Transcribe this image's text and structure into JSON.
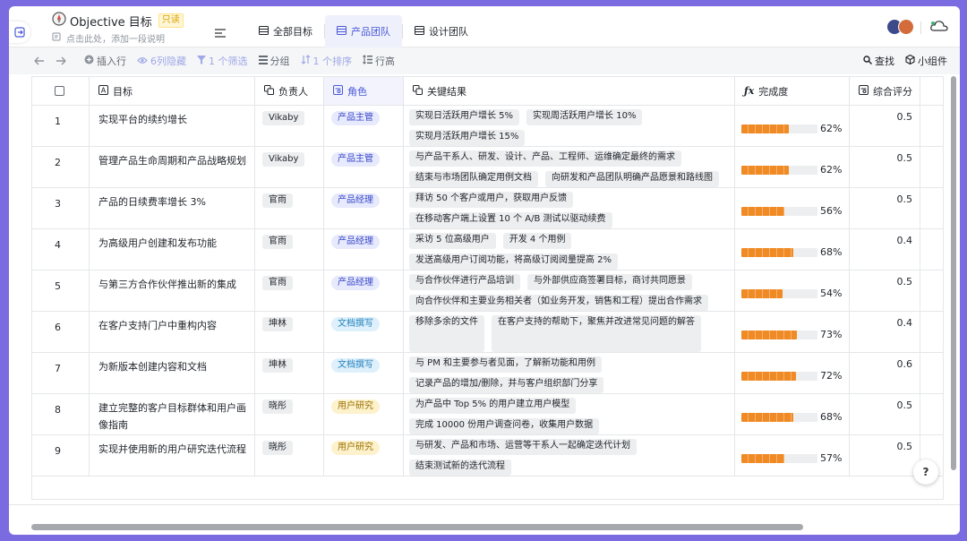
{
  "app": {
    "title": "Objective 目标",
    "readonly_badge": "只读",
    "description": "点击此处，添加一段说明"
  },
  "tabs": [
    {
      "label": "全部目标",
      "active": false
    },
    {
      "label": "产品团队",
      "active": true
    },
    {
      "label": "设计团队",
      "active": false
    }
  ],
  "toolbar": {
    "insert_row": "插入行",
    "hidden_cols": "6列隐藏",
    "filter": "1 个筛选",
    "group": "分组",
    "sort": "1 个排序",
    "row_height": "行高",
    "find": "查找",
    "widgets": "小组件"
  },
  "columns": [
    "目标",
    "负责人",
    "角色",
    "关键结果",
    "完成度",
    "综合评分"
  ],
  "role_colors": {
    "产品主管": {
      "bg": "#e7e9fc",
      "fg": "#3a49c9"
    },
    "产品经理": {
      "bg": "#e7e9fc",
      "fg": "#3a49c9"
    },
    "文档撰写": {
      "bg": "#ddf0fb",
      "fg": "#2581bd"
    },
    "用户研究": {
      "bg": "#fdf2cc",
      "fg": "#9a6f00"
    }
  },
  "accent_color": "#f08a24",
  "rows": [
    {
      "num": "1",
      "objective": "实现平台的续约增长",
      "owner": "Vikaby",
      "role": "产品主管",
      "key_results": [
        "实现日活跃用户增长 5%",
        "实现周活跃用户增长 10%",
        "实现月活跃用户增长 15%"
      ],
      "progress": 62,
      "progress_label": "62%",
      "score": "0.5"
    },
    {
      "num": "2",
      "objective": "管理产品生命周期和产品战略规划",
      "owner": "Vikaby",
      "role": "产品主管",
      "key_results": [
        "与产品干系人、研发、设计、产品、工程师、运维确定最终的需求",
        "结束与市场团队确定用例文档",
        "向研发和产品团队明确产品愿景和路线图"
      ],
      "progress": 62,
      "progress_label": "62%",
      "score": "0.5"
    },
    {
      "num": "3",
      "objective": "产品的日续费率增长 3%",
      "owner": "官雨",
      "role": "产品经理",
      "key_results": [
        "拜访 50 个客户或用户，获取用户反馈",
        "在移动客户端上设置 10 个 A/B 测试以驱动续费"
      ],
      "progress": 56,
      "progress_label": "56%",
      "score": "0.5"
    },
    {
      "num": "4",
      "objective": "为高级用户创建和发布功能",
      "owner": "官雨",
      "role": "产品经理",
      "key_results": [
        "采访 5 位高级用户",
        "开发 4 个用例",
        "发送高级用户订阅功能，将高级订阅阅量提高 2%"
      ],
      "progress": 68,
      "progress_label": "68%",
      "score": "0.4"
    },
    {
      "num": "5",
      "objective": "与第三方合作伙伴推出新的集成",
      "owner": "官雨",
      "role": "产品经理",
      "key_results": [
        "与合作伙伴进行产品培训",
        "与外部供应商签署目标，商讨共同愿景",
        "向合作伙伴和主要业务相关者（如业务开发，销售和工程）提出合作需求"
      ],
      "progress": 54,
      "progress_label": "54%",
      "score": "0.5"
    },
    {
      "num": "6",
      "objective": "在客户支持门户中重构内容",
      "owner": "坤林",
      "role": "文档撰写",
      "key_results": [
        "移除多余的文件",
        "在客户支持的帮助下，聚焦并改进常见问题的解答"
      ],
      "progress": 73,
      "progress_label": "73%",
      "score": "0.4"
    },
    {
      "num": "7",
      "objective": "为新版本创建内容和文档",
      "owner": "坤林",
      "role": "文档撰写",
      "key_results": [
        "与 PM 和主要参与者见面，了解新功能和用例",
        "记录产品的增加/删除，并与客户组织部门分享"
      ],
      "progress": 72,
      "progress_label": "72%",
      "score": "0.6"
    },
    {
      "num": "8",
      "objective": "建立完整的客户目标群体和用户画像指南",
      "owner": "晓彤",
      "role": "用户研究",
      "key_results": [
        "为产品中 Top 5% 的用户建立用户模型",
        "完成 10000 份用户调查问卷，收集用户数据"
      ],
      "progress": 68,
      "progress_label": "68%",
      "score": "0.5"
    },
    {
      "num": "9",
      "objective": "实现并使用新的用户研究迭代流程",
      "owner": "晓彤",
      "role": "用户研究",
      "key_results": [
        "与研发、产品和市场、运营等干系人一起确定迭代计划",
        "结束测试新的迭代流程"
      ],
      "progress": 57,
      "progress_label": "57%",
      "score": "0.5"
    }
  ],
  "help_label": "?"
}
